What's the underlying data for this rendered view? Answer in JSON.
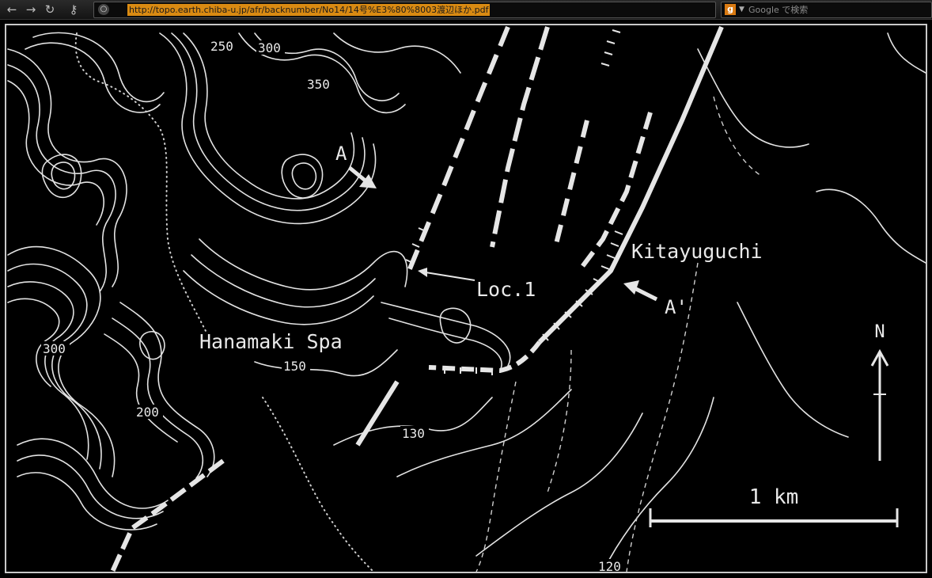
{
  "browser": {
    "url": "http://topo.earth.chiba-u.jp/afr/backnumber/No14/14号%E3%80%8003渡辺ほか.pdf",
    "search_placeholder": "Google で検索",
    "search_engine_icon": "g"
  },
  "map": {
    "place_labels": {
      "hanamaki_spa": "Hanamaki Spa",
      "kitayuguchi": "Kitayuguchi",
      "loc1": "Loc.1"
    },
    "section_labels": {
      "a": "A",
      "a_prime": "A'"
    },
    "contour_labels": [
      "250",
      "300",
      "350",
      "300",
      "200",
      "150",
      "130",
      "120"
    ],
    "north_label": "N",
    "scale_label": "1 km"
  },
  "colors": {
    "background": "#000000",
    "lines": "#e6e6e6",
    "url_highlight": "#d98a12"
  }
}
